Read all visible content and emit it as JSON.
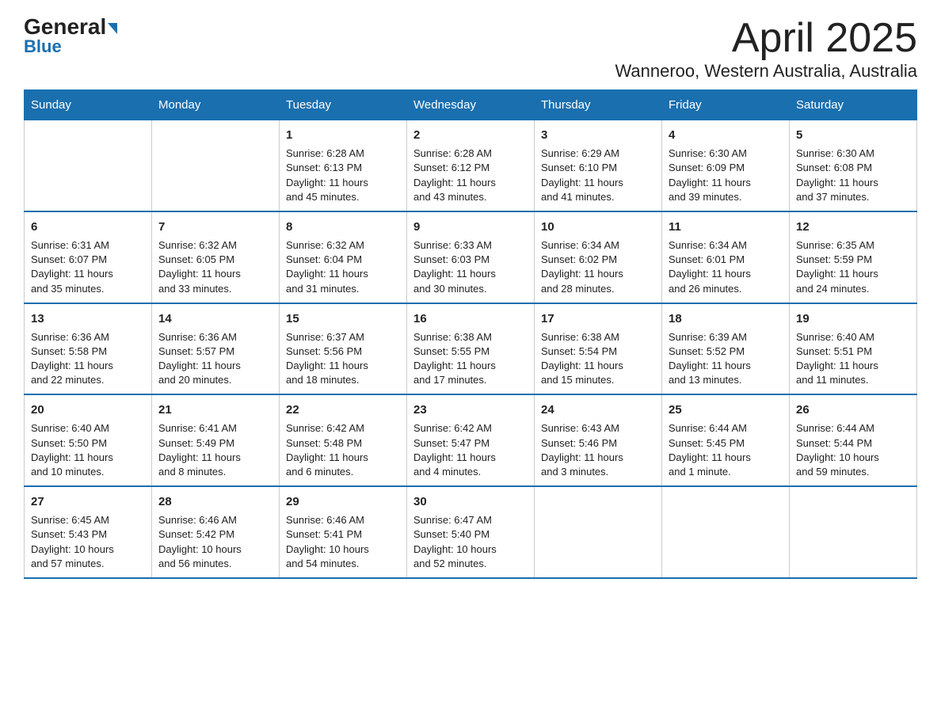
{
  "header": {
    "logo_general": "General",
    "logo_blue": "Blue",
    "month_title": "April 2025",
    "location": "Wanneroo, Western Australia, Australia"
  },
  "days_of_week": [
    "Sunday",
    "Monday",
    "Tuesday",
    "Wednesday",
    "Thursday",
    "Friday",
    "Saturday"
  ],
  "weeks": [
    [
      {
        "day": "",
        "info": ""
      },
      {
        "day": "",
        "info": ""
      },
      {
        "day": "1",
        "info": "Sunrise: 6:28 AM\nSunset: 6:13 PM\nDaylight: 11 hours\nand 45 minutes."
      },
      {
        "day": "2",
        "info": "Sunrise: 6:28 AM\nSunset: 6:12 PM\nDaylight: 11 hours\nand 43 minutes."
      },
      {
        "day": "3",
        "info": "Sunrise: 6:29 AM\nSunset: 6:10 PM\nDaylight: 11 hours\nand 41 minutes."
      },
      {
        "day": "4",
        "info": "Sunrise: 6:30 AM\nSunset: 6:09 PM\nDaylight: 11 hours\nand 39 minutes."
      },
      {
        "day": "5",
        "info": "Sunrise: 6:30 AM\nSunset: 6:08 PM\nDaylight: 11 hours\nand 37 minutes."
      }
    ],
    [
      {
        "day": "6",
        "info": "Sunrise: 6:31 AM\nSunset: 6:07 PM\nDaylight: 11 hours\nand 35 minutes."
      },
      {
        "day": "7",
        "info": "Sunrise: 6:32 AM\nSunset: 6:05 PM\nDaylight: 11 hours\nand 33 minutes."
      },
      {
        "day": "8",
        "info": "Sunrise: 6:32 AM\nSunset: 6:04 PM\nDaylight: 11 hours\nand 31 minutes."
      },
      {
        "day": "9",
        "info": "Sunrise: 6:33 AM\nSunset: 6:03 PM\nDaylight: 11 hours\nand 30 minutes."
      },
      {
        "day": "10",
        "info": "Sunrise: 6:34 AM\nSunset: 6:02 PM\nDaylight: 11 hours\nand 28 minutes."
      },
      {
        "day": "11",
        "info": "Sunrise: 6:34 AM\nSunset: 6:01 PM\nDaylight: 11 hours\nand 26 minutes."
      },
      {
        "day": "12",
        "info": "Sunrise: 6:35 AM\nSunset: 5:59 PM\nDaylight: 11 hours\nand 24 minutes."
      }
    ],
    [
      {
        "day": "13",
        "info": "Sunrise: 6:36 AM\nSunset: 5:58 PM\nDaylight: 11 hours\nand 22 minutes."
      },
      {
        "day": "14",
        "info": "Sunrise: 6:36 AM\nSunset: 5:57 PM\nDaylight: 11 hours\nand 20 minutes."
      },
      {
        "day": "15",
        "info": "Sunrise: 6:37 AM\nSunset: 5:56 PM\nDaylight: 11 hours\nand 18 minutes."
      },
      {
        "day": "16",
        "info": "Sunrise: 6:38 AM\nSunset: 5:55 PM\nDaylight: 11 hours\nand 17 minutes."
      },
      {
        "day": "17",
        "info": "Sunrise: 6:38 AM\nSunset: 5:54 PM\nDaylight: 11 hours\nand 15 minutes."
      },
      {
        "day": "18",
        "info": "Sunrise: 6:39 AM\nSunset: 5:52 PM\nDaylight: 11 hours\nand 13 minutes."
      },
      {
        "day": "19",
        "info": "Sunrise: 6:40 AM\nSunset: 5:51 PM\nDaylight: 11 hours\nand 11 minutes."
      }
    ],
    [
      {
        "day": "20",
        "info": "Sunrise: 6:40 AM\nSunset: 5:50 PM\nDaylight: 11 hours\nand 10 minutes."
      },
      {
        "day": "21",
        "info": "Sunrise: 6:41 AM\nSunset: 5:49 PM\nDaylight: 11 hours\nand 8 minutes."
      },
      {
        "day": "22",
        "info": "Sunrise: 6:42 AM\nSunset: 5:48 PM\nDaylight: 11 hours\nand 6 minutes."
      },
      {
        "day": "23",
        "info": "Sunrise: 6:42 AM\nSunset: 5:47 PM\nDaylight: 11 hours\nand 4 minutes."
      },
      {
        "day": "24",
        "info": "Sunrise: 6:43 AM\nSunset: 5:46 PM\nDaylight: 11 hours\nand 3 minutes."
      },
      {
        "day": "25",
        "info": "Sunrise: 6:44 AM\nSunset: 5:45 PM\nDaylight: 11 hours\nand 1 minute."
      },
      {
        "day": "26",
        "info": "Sunrise: 6:44 AM\nSunset: 5:44 PM\nDaylight: 10 hours\nand 59 minutes."
      }
    ],
    [
      {
        "day": "27",
        "info": "Sunrise: 6:45 AM\nSunset: 5:43 PM\nDaylight: 10 hours\nand 57 minutes."
      },
      {
        "day": "28",
        "info": "Sunrise: 6:46 AM\nSunset: 5:42 PM\nDaylight: 10 hours\nand 56 minutes."
      },
      {
        "day": "29",
        "info": "Sunrise: 6:46 AM\nSunset: 5:41 PM\nDaylight: 10 hours\nand 54 minutes."
      },
      {
        "day": "30",
        "info": "Sunrise: 6:47 AM\nSunset: 5:40 PM\nDaylight: 10 hours\nand 52 minutes."
      },
      {
        "day": "",
        "info": ""
      },
      {
        "day": "",
        "info": ""
      },
      {
        "day": "",
        "info": ""
      }
    ]
  ]
}
